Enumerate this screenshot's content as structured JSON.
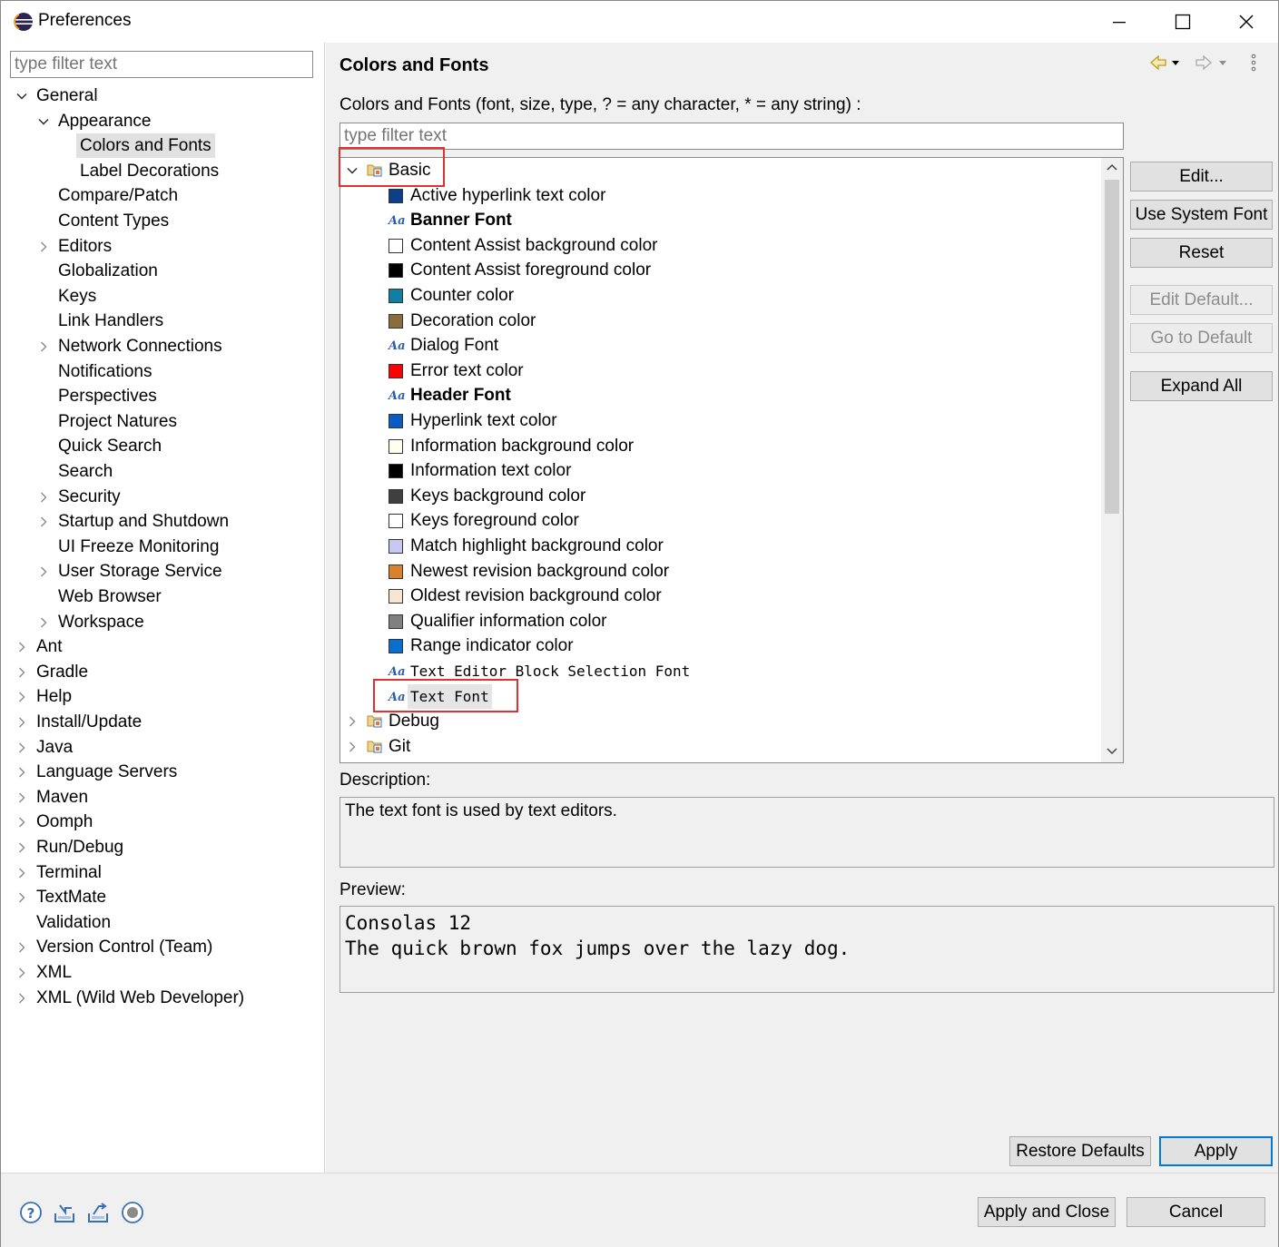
{
  "window": {
    "title": "Preferences"
  },
  "left": {
    "filter_placeholder": "type filter text",
    "items": [
      {
        "label": "General",
        "level": 0,
        "expander": "expanded"
      },
      {
        "label": "Appearance",
        "level": 1,
        "expander": "expanded"
      },
      {
        "label": "Colors and Fonts",
        "level": 2,
        "expander": "none",
        "selected": true
      },
      {
        "label": "Label Decorations",
        "level": 2,
        "expander": "none"
      },
      {
        "label": "Compare/Patch",
        "level": 1,
        "expander": "none"
      },
      {
        "label": "Content Types",
        "level": 1,
        "expander": "none"
      },
      {
        "label": "Editors",
        "level": 1,
        "expander": "collapsed"
      },
      {
        "label": "Globalization",
        "level": 1,
        "expander": "none"
      },
      {
        "label": "Keys",
        "level": 1,
        "expander": "none"
      },
      {
        "label": "Link Handlers",
        "level": 1,
        "expander": "none"
      },
      {
        "label": "Network Connections",
        "level": 1,
        "expander": "collapsed"
      },
      {
        "label": "Notifications",
        "level": 1,
        "expander": "none"
      },
      {
        "label": "Perspectives",
        "level": 1,
        "expander": "none"
      },
      {
        "label": "Project Natures",
        "level": 1,
        "expander": "none"
      },
      {
        "label": "Quick Search",
        "level": 1,
        "expander": "none"
      },
      {
        "label": "Search",
        "level": 1,
        "expander": "none"
      },
      {
        "label": "Security",
        "level": 1,
        "expander": "collapsed"
      },
      {
        "label": "Startup and Shutdown",
        "level": 1,
        "expander": "collapsed"
      },
      {
        "label": "UI Freeze Monitoring",
        "level": 1,
        "expander": "none"
      },
      {
        "label": "User Storage Service",
        "level": 1,
        "expander": "collapsed"
      },
      {
        "label": "Web Browser",
        "level": 1,
        "expander": "none"
      },
      {
        "label": "Workspace",
        "level": 1,
        "expander": "collapsed"
      },
      {
        "label": "Ant",
        "level": 0,
        "expander": "collapsed"
      },
      {
        "label": "Gradle",
        "level": 0,
        "expander": "collapsed"
      },
      {
        "label": "Help",
        "level": 0,
        "expander": "collapsed"
      },
      {
        "label": "Install/Update",
        "level": 0,
        "expander": "collapsed"
      },
      {
        "label": "Java",
        "level": 0,
        "expander": "collapsed"
      },
      {
        "label": "Language Servers",
        "level": 0,
        "expander": "collapsed"
      },
      {
        "label": "Maven",
        "level": 0,
        "expander": "collapsed"
      },
      {
        "label": "Oomph",
        "level": 0,
        "expander": "collapsed"
      },
      {
        "label": "Run/Debug",
        "level": 0,
        "expander": "collapsed"
      },
      {
        "label": "Terminal",
        "level": 0,
        "expander": "collapsed"
      },
      {
        "label": "TextMate",
        "level": 0,
        "expander": "collapsed"
      },
      {
        "label": "Validation",
        "level": 0,
        "expander": "none"
      },
      {
        "label": "Version Control (Team)",
        "level": 0,
        "expander": "collapsed"
      },
      {
        "label": "XML",
        "level": 0,
        "expander": "collapsed"
      },
      {
        "label": "XML (Wild Web Developer)",
        "level": 0,
        "expander": "collapsed"
      }
    ]
  },
  "page": {
    "title": "Colors and Fonts",
    "filter_label": "Colors and Fonts (font, size, type, ? = any character, * = any string) :",
    "filter_placeholder": "type filter text"
  },
  "tree": {
    "rows": [
      {
        "kind": "category",
        "label": "Basic",
        "expander": "expanded"
      },
      {
        "kind": "color",
        "label": "Active hyperlink text color",
        "color": "#0b3f8a"
      },
      {
        "kind": "font",
        "label": "Banner Font",
        "style": "bold"
      },
      {
        "kind": "color",
        "label": "Content Assist background color",
        "color": "#ffffff"
      },
      {
        "kind": "color",
        "label": "Content Assist foreground color",
        "color": "#000000"
      },
      {
        "kind": "color",
        "label": "Counter color",
        "color": "#0f7fa5"
      },
      {
        "kind": "color",
        "label": "Decoration color",
        "color": "#8a6d3b"
      },
      {
        "kind": "font",
        "label": "Dialog Font",
        "style": "normal"
      },
      {
        "kind": "color",
        "label": "Error text color",
        "color": "#ff0000"
      },
      {
        "kind": "font",
        "label": "Header Font",
        "style": "bold"
      },
      {
        "kind": "color",
        "label": "Hyperlink text color",
        "color": "#0a5cc4"
      },
      {
        "kind": "color",
        "label": "Information background color",
        "color": "#fffff0"
      },
      {
        "kind": "color",
        "label": "Information text color",
        "color": "#000000"
      },
      {
        "kind": "color",
        "label": "Keys background color",
        "color": "#3f3f3f"
      },
      {
        "kind": "color",
        "label": "Keys foreground color",
        "color": "#ffffff"
      },
      {
        "kind": "color",
        "label": "Match highlight background color",
        "color": "#c8c8f0"
      },
      {
        "kind": "color",
        "label": "Newest revision background color",
        "color": "#d9822b"
      },
      {
        "kind": "color",
        "label": "Oldest revision background color",
        "color": "#f7e6d2"
      },
      {
        "kind": "color",
        "label": "Qualifier information color",
        "color": "#808080"
      },
      {
        "kind": "color",
        "label": "Range indicator color",
        "color": "#0a6ed1"
      },
      {
        "kind": "font",
        "label": "Text Editor Block Selection Font",
        "style": "mono"
      },
      {
        "kind": "font",
        "label": "Text Font",
        "style": "mono",
        "selected": true
      },
      {
        "kind": "category",
        "label": "Debug",
        "expander": "collapsed"
      },
      {
        "kind": "category",
        "label": "Git",
        "expander": "collapsed"
      }
    ]
  },
  "buttons": {
    "edit": "Edit...",
    "use_system_font": "Use System Font",
    "reset": "Reset",
    "edit_default": "Edit Default...",
    "go_to_default": "Go to Default",
    "expand_all": "Expand All",
    "restore_defaults": "Restore Defaults",
    "apply": "Apply",
    "apply_and_close": "Apply and Close",
    "cancel": "Cancel"
  },
  "description": {
    "label": "Description:",
    "text": "The text font is used by text editors."
  },
  "preview": {
    "label": "Preview:",
    "line1": "Consolas 12",
    "line2": "The quick brown fox jumps over the lazy dog."
  },
  "footer_icons": [
    "help-icon",
    "import-icon",
    "export-icon",
    "record-icon"
  ]
}
